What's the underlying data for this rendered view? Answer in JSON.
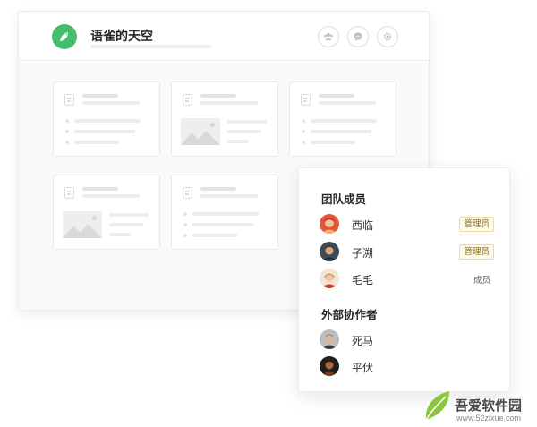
{
  "app": {
    "space_title": "语雀的天空",
    "header_buttons": [
      {
        "icon": "members-icon"
      },
      {
        "icon": "chat-icon"
      },
      {
        "icon": "gear-icon"
      }
    ],
    "accent_color": "#45bd6b"
  },
  "members_panel": {
    "team_title": "团队成员",
    "team_members": [
      {
        "name": "西临",
        "role": "管理员"
      },
      {
        "name": "子溯",
        "role": "管理员"
      },
      {
        "name": "毛毛",
        "role": "成员"
      }
    ],
    "collaborators_title": "外部协作者",
    "collaborators": [
      {
        "name": "死马"
      },
      {
        "name": "平伏"
      }
    ],
    "badge_color": "#f0d99a"
  },
  "watermark": {
    "brand": "吾爱软件园",
    "url": "www.52zixue.com"
  }
}
